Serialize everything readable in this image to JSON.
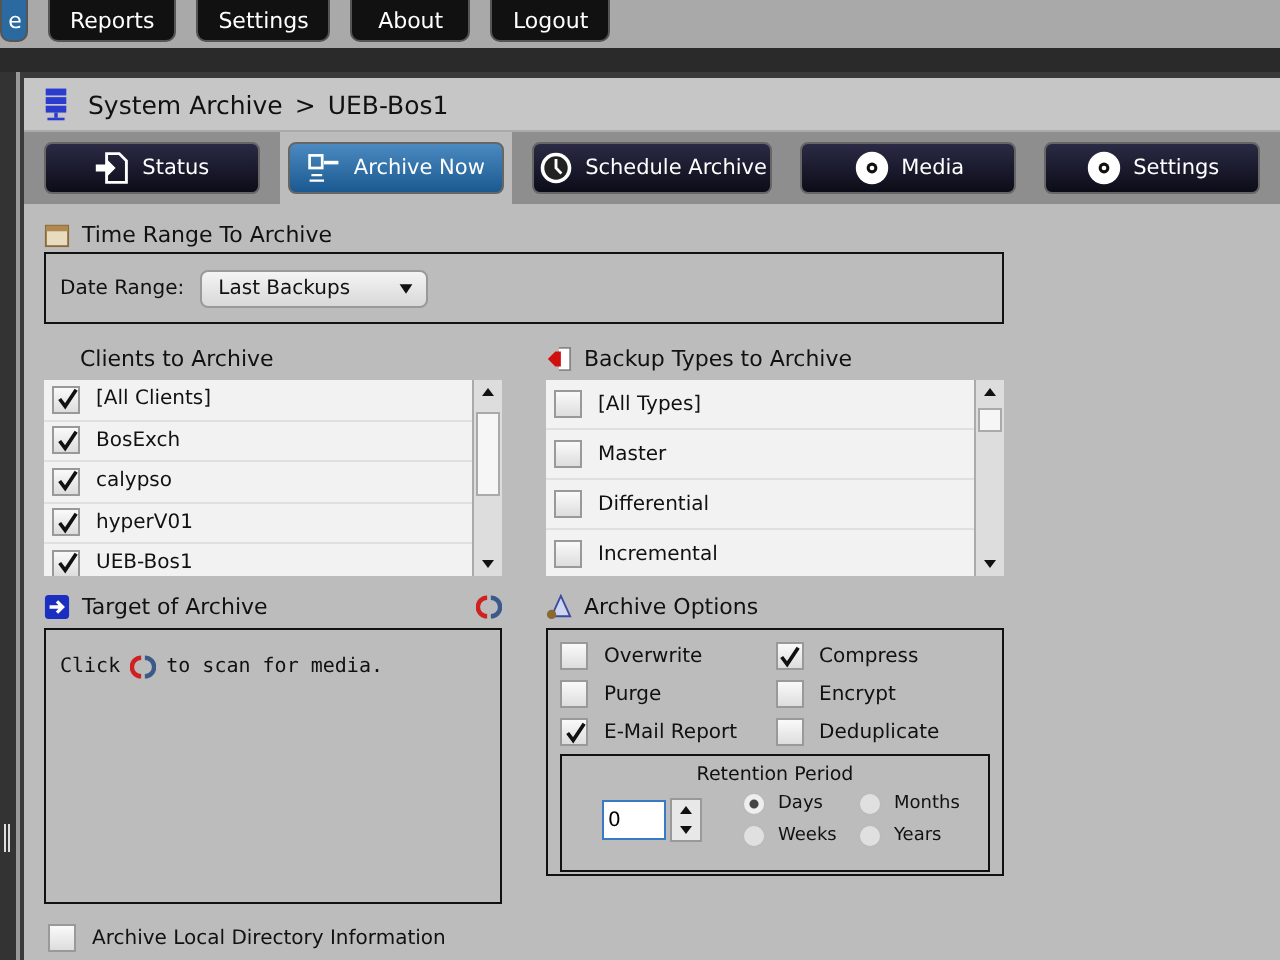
{
  "top_nav": [
    {
      "label": "e",
      "selected": true
    },
    {
      "label": "Reports",
      "selected": false
    },
    {
      "label": "Settings",
      "selected": false
    },
    {
      "label": "About",
      "selected": false
    },
    {
      "label": "Logout",
      "selected": false
    }
  ],
  "breadcrumb": {
    "root": "System Archive",
    "separator": ">",
    "current": "UEB-Bos1"
  },
  "tabs": [
    {
      "label": "Status",
      "kind": "document",
      "selected": false
    },
    {
      "label": "Archive Now",
      "kind": "archive",
      "selected": true
    },
    {
      "label": "Schedule Archive",
      "kind": "clock",
      "selected": false
    },
    {
      "label": "Media",
      "kind": "disc",
      "selected": false
    },
    {
      "label": "Settings",
      "kind": "disc",
      "selected": false
    }
  ],
  "time_range": {
    "title": "Time Range To Archive",
    "label": "Date Range:",
    "value": "Last Backups"
  },
  "clients": {
    "title": "Clients to Archive",
    "items": [
      {
        "label": "[All Clients]",
        "checked": true
      },
      {
        "label": "BosExch",
        "checked": true
      },
      {
        "label": "calypso",
        "checked": true
      },
      {
        "label": "hyperV01",
        "checked": true
      },
      {
        "label": "UEB-Bos1",
        "checked": true
      }
    ]
  },
  "backup_types": {
    "title": "Backup Types to Archive",
    "items": [
      {
        "label": "[All Types]",
        "checked": false
      },
      {
        "label": "Master",
        "checked": false
      },
      {
        "label": "Differential",
        "checked": false
      },
      {
        "label": "Incremental",
        "checked": false
      }
    ]
  },
  "target": {
    "title": "Target of Archive",
    "hint_before": "Click",
    "hint_after": "to scan for media."
  },
  "options": {
    "title": "Archive Options",
    "items": [
      {
        "label": "Overwrite",
        "checked": false
      },
      {
        "label": "Compress",
        "checked": true
      },
      {
        "label": "Purge",
        "checked": false
      },
      {
        "label": "Encrypt",
        "checked": false
      },
      {
        "label": "E-Mail Report",
        "checked": true
      },
      {
        "label": "Deduplicate",
        "checked": false
      }
    ],
    "retention": {
      "title": "Retention Period",
      "value": "0",
      "units": [
        {
          "label": "Days",
          "selected": true
        },
        {
          "label": "Months",
          "selected": false
        },
        {
          "label": "Weeks",
          "selected": false
        },
        {
          "label": "Years",
          "selected": false
        }
      ]
    }
  },
  "local_dir": {
    "label": "Archive Local Directory Information",
    "checked": false
  }
}
